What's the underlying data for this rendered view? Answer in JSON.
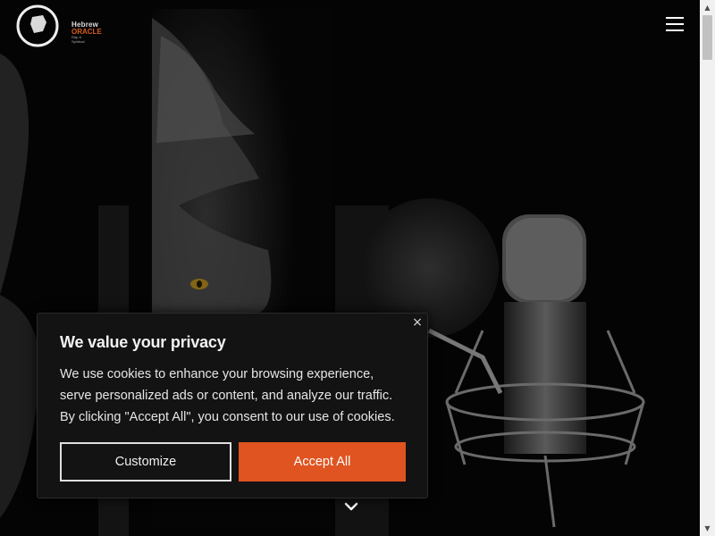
{
  "logo": {
    "line1": "Hebrew",
    "line2": "ORACLE",
    "line3": "Rap & Spiritual"
  },
  "header": {
    "menu_icon": "hamburger-menu-icon"
  },
  "hero": {
    "scroll_icon": "chevron-down-icon"
  },
  "cookie_banner": {
    "title": "We value your privacy",
    "body_line1": "We use cookies to enhance your browsing experience,",
    "body_line2": "serve personalized ads or content, and analyze our traffic.",
    "body_line3": "By clicking \"Accept All\", you consent to our use of cookies.",
    "close_label": "×",
    "customize_label": "Customize",
    "accept_label": "Accept All",
    "accent_color": "#df5420"
  },
  "scrollbar": {
    "up_arrow": "▲",
    "down_arrow": "▼"
  }
}
